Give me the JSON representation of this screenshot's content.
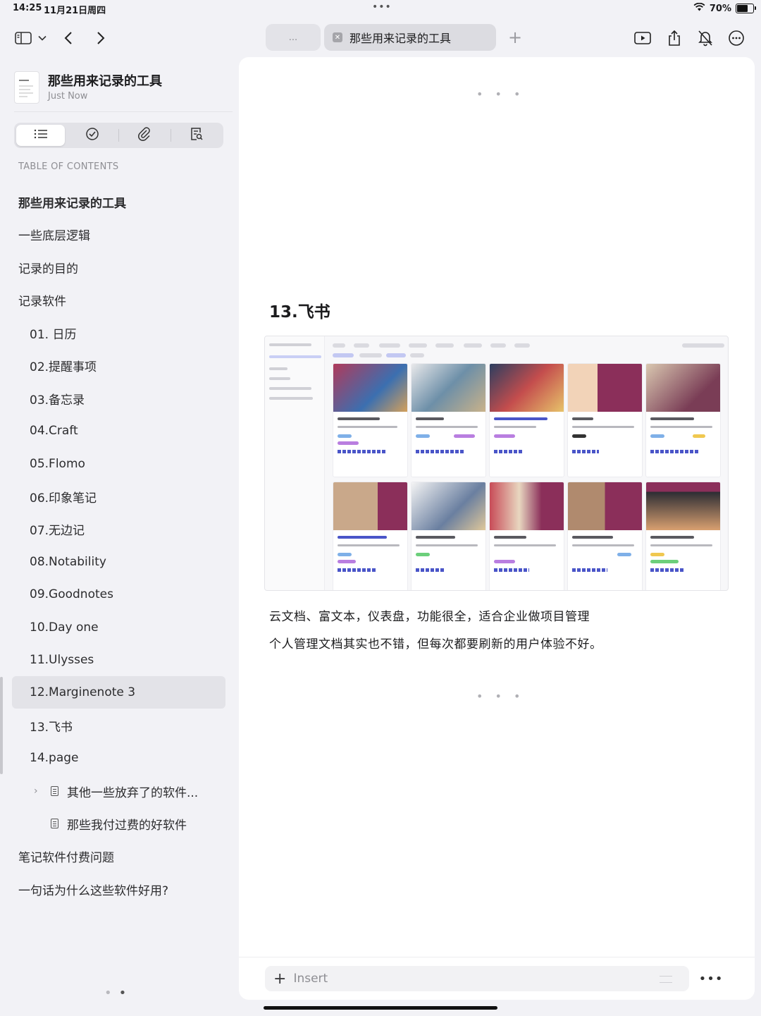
{
  "status": {
    "time": "14:25",
    "date": "11月21日周四",
    "battery": "70%",
    "battery_level": 0.7
  },
  "tabs": {
    "ghost_label": "...",
    "active_title": "那些用来记录的工具"
  },
  "sidebar": {
    "doc_title": "那些用来记录的工具",
    "doc_subtitle": "Just Now",
    "toc_heading": "TABLE OF CONTENTS",
    "items": [
      {
        "label": "那些用来记录的工具",
        "level": 0
      },
      {
        "label": "一些底层逻辑",
        "level": 0
      },
      {
        "label": "记录的目的",
        "level": 0
      },
      {
        "label": "记录软件",
        "level": 0
      },
      {
        "label": "01. 日历",
        "level": 1
      },
      {
        "label": "02.提醒事项",
        "level": 1
      },
      {
        "label": "03.备忘录",
        "level": 1
      },
      {
        "label": "04.Craft",
        "level": 1
      },
      {
        "label": "05.Flomo",
        "level": 1
      },
      {
        "label": "06.印象笔记",
        "level": 1
      },
      {
        "label": "07.无边记",
        "level": 1
      },
      {
        "label": "08.Notability",
        "level": 1
      },
      {
        "label": "09.Goodnotes",
        "level": 1
      },
      {
        "label": "10.Day one",
        "level": 1
      },
      {
        "label": "11.Ulysses",
        "level": 1
      },
      {
        "label": "12.Marginenote 3",
        "level": 1
      },
      {
        "label": "13.飞书",
        "level": 1
      },
      {
        "label": "14.page",
        "level": 1
      },
      {
        "label": "其他一些放弃了的软件...",
        "level": 2
      },
      {
        "label": "那些我付过费的好软件",
        "level": 2
      },
      {
        "label": "笔记软件付费问题",
        "level": 0
      },
      {
        "label": "一句话为什么这些软件好用?",
        "level": 0
      }
    ]
  },
  "main": {
    "heading": "13.飞书",
    "paragraphs": [
      "云文档、富文本，仪表盘，功能很全，适合企业做项目管理",
      "个人管理文档其实也不错，但每次都要刷新的用户体验不好。"
    ],
    "insert_placeholder": "Insert"
  },
  "colors": {
    "accent": "#4a55c8",
    "card_purple": "#8b2f5a"
  }
}
